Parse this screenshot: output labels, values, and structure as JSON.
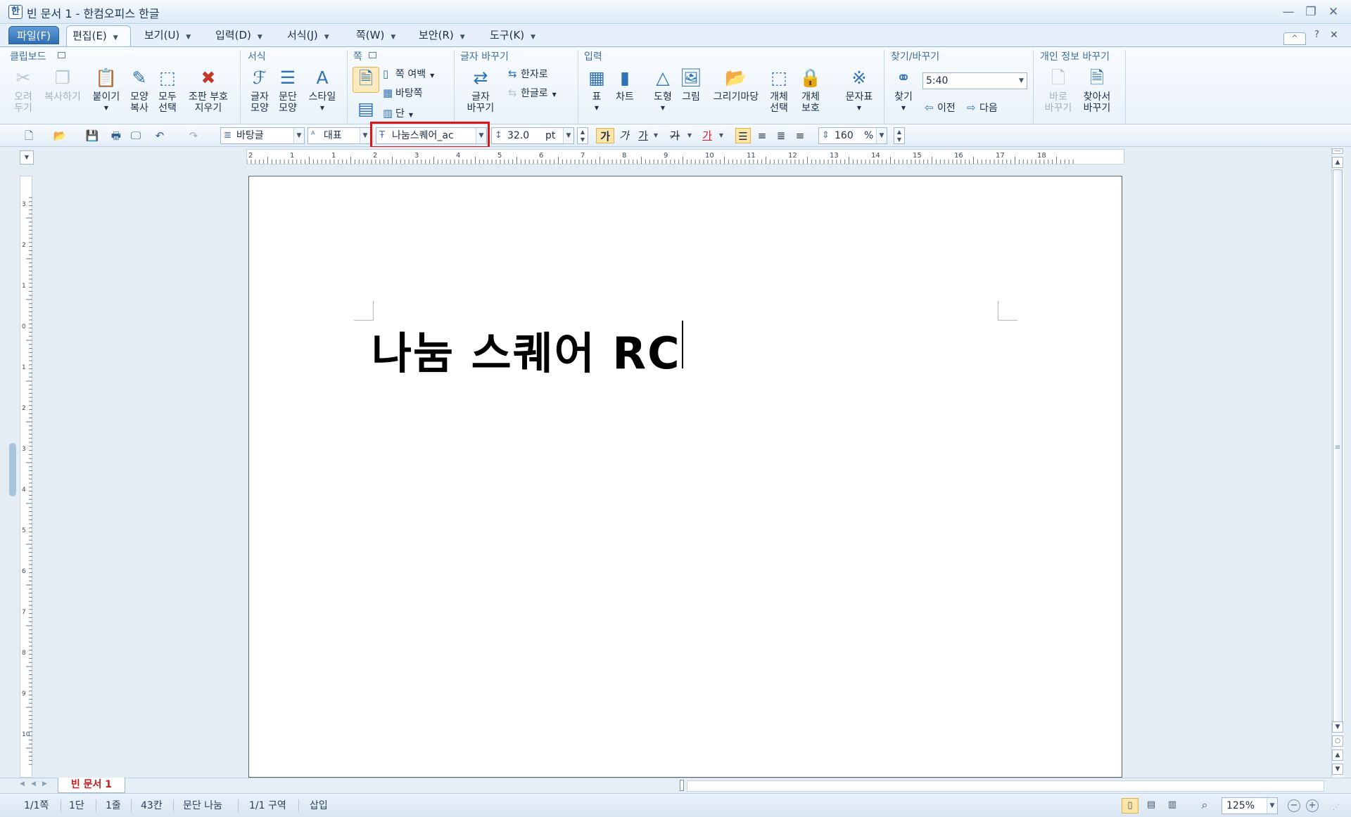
{
  "window": {
    "title": "빈 문서 1 - 한컴오피스 한글",
    "minimize": "—",
    "restore": "❐",
    "close": "✕"
  },
  "menu": {
    "file": "파일(F)",
    "edit": "편집(E)",
    "view": "보기(U)",
    "insert": "입력(D)",
    "format": "서식(J)",
    "page": "쪽(W)",
    "security": "보안(R)",
    "tools": "도구(K)",
    "help": "?"
  },
  "ribbon": {
    "groups": {
      "clipboard": "클립보드",
      "format": "서식",
      "page": "쪽",
      "char_replace": "글자 바꾸기",
      "insert": "입력",
      "find_replace": "찾기/바꾸기",
      "privacy": "개인 정보 바꾸기"
    },
    "clipboard": {
      "cut": [
        "오려",
        "두기"
      ],
      "copy": "복사하기",
      "paste": "붙이기",
      "format_copy": [
        "모양",
        "복사"
      ],
      "select_all": [
        "모두",
        "선택"
      ],
      "clear_marks": [
        "조판 부호",
        "지우기"
      ]
    },
    "format": {
      "char_shape": [
        "글자",
        "모양"
      ],
      "para_shape": [
        "문단",
        "모양"
      ],
      "style": "스타일"
    },
    "page": {
      "margin": "쪽 여백",
      "background": "바탕쪽",
      "column": "단"
    },
    "char_replace": {
      "replace": [
        "글자",
        "바꾸기"
      ],
      "to_hanja": "한자로",
      "to_hangul": "한글로"
    },
    "insert": {
      "table": "표",
      "chart": "차트",
      "shape": "도형",
      "picture": "그림",
      "drawing_gallery": "그리기마당",
      "object_select": [
        "개체",
        "선택"
      ],
      "object_protect": [
        "개체",
        "보호"
      ],
      "symbols": "문자표"
    },
    "find": {
      "find": "찾기",
      "search_value": "5:40",
      "prev": "이전",
      "next": "다음"
    },
    "privacy": {
      "replace_now": [
        "바로",
        "바꾸기"
      ],
      "find_replace": [
        "찾아서",
        "바꾸기"
      ]
    }
  },
  "toolbar": {
    "style": "바탕글",
    "lang": "대표",
    "font": "나눔스퀘어_ac",
    "size": "32.0",
    "size_unit": "pt",
    "bold": "가",
    "italic": "가",
    "underline": "가",
    "strike": "가",
    "color": "가",
    "line_spacing": "160",
    "line_spacing_unit": "%"
  },
  "ruler": {
    "h": [
      "2",
      "1",
      "1",
      "2",
      "3",
      "4",
      "5",
      "6",
      "7",
      "8",
      "9",
      "10",
      "11",
      "12",
      "13",
      "14",
      "15",
      "16",
      "17",
      "18"
    ],
    "v": [
      "3",
      "2",
      "1",
      "0",
      "1",
      "2",
      "3",
      "4",
      "5",
      "6",
      "7",
      "8",
      "9",
      "10"
    ]
  },
  "document": {
    "text": "나눔 스퀘어 RC",
    "tab": "빈 문서 1"
  },
  "status": {
    "page": "1/1쪽",
    "column": "1단",
    "line": "1줄",
    "col": "43칸",
    "para": "문단 나눔",
    "section": "1/1 구역",
    "mode": "삽입",
    "zoom": "125%"
  }
}
